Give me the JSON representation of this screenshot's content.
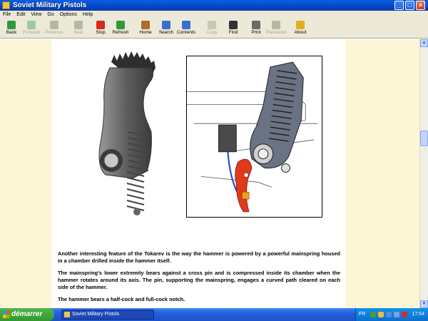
{
  "window": {
    "title": "Soviet Military Pistols"
  },
  "menu": [
    "File",
    "Edit",
    "View",
    "Go",
    "Options",
    "Help"
  ],
  "toolbar": [
    {
      "label": "Back",
      "icon": "back-icon",
      "enabled": true,
      "color": "#2e9a3a"
    },
    {
      "label": "Forward",
      "icon": "forward-icon",
      "enabled": false,
      "color": "#9ec9a0"
    },
    {
      "label": "Previous",
      "icon": "previous-icon",
      "enabled": false,
      "color": "#b8b6a4"
    },
    {
      "label": "Next",
      "icon": "next-icon",
      "enabled": false,
      "color": "#b8b6a4"
    },
    {
      "label": "Stop",
      "icon": "stop-icon",
      "enabled": true,
      "color": "#d42a1e"
    },
    {
      "label": "Refresh",
      "icon": "refresh-icon",
      "enabled": true,
      "color": "#2e9a3a"
    },
    {
      "label": "Home",
      "icon": "home-icon",
      "enabled": true,
      "color": "#b36a2a"
    },
    {
      "label": "Search",
      "icon": "search-icon",
      "enabled": true,
      "color": "#3a6fd0"
    },
    {
      "label": "Contents",
      "icon": "contents-icon",
      "enabled": true,
      "color": "#3a6fd0"
    },
    {
      "label": "Copy",
      "icon": "copy-icon",
      "enabled": false,
      "color": "#c8c6b4"
    },
    {
      "label": "Find",
      "icon": "find-icon",
      "enabled": true,
      "color": "#333333"
    },
    {
      "label": "Print",
      "icon": "print-icon",
      "enabled": true,
      "color": "#6a6a6a"
    },
    {
      "label": "Password",
      "icon": "password-icon",
      "enabled": false,
      "color": "#b8b6a4"
    },
    {
      "label": "About",
      "icon": "about-icon",
      "enabled": true,
      "color": "#e0b020"
    }
  ],
  "article": {
    "paragraphs": [
      "Another interesting feature of the Tokarev is the way the hammer is powered by a powerful mainspring housed in a chamber drilled inside the hammer itself.",
      "The mainspring's lower extremity bears against a cross pin and is compressed inside its chamber when the hammer rotates around its axis. The pin, supporting the mainspring, engages a curved path cleared on each side of the hammer.",
      "The hammer bears a half-cock and full-cock notch."
    ]
  },
  "taskbar": {
    "start_label": "démarrer",
    "task_title": "Soviet Military Pistols",
    "language": "FR",
    "clock": "17:54"
  }
}
